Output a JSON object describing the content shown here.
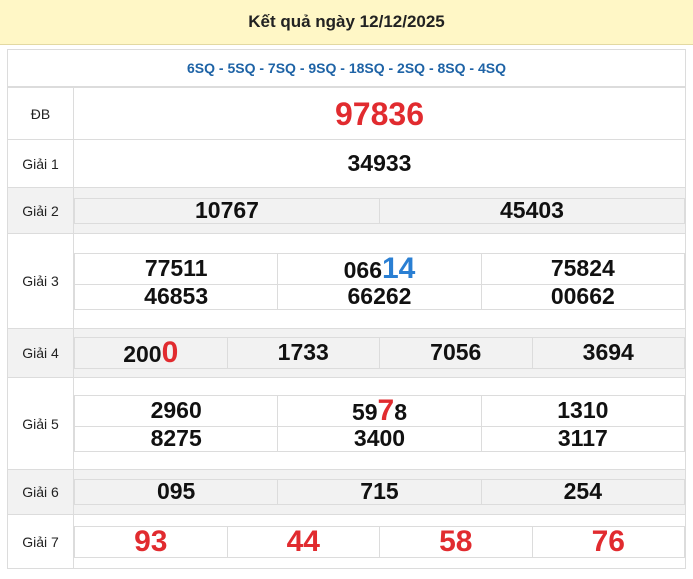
{
  "header": {
    "title": "Kết quả ngày 12/12/2025"
  },
  "codes": "6SQ - 5SQ - 7SQ - 9SQ - 18SQ - 2SQ - 8SQ - 4SQ",
  "db": {
    "label": "ĐB",
    "value": "97836"
  },
  "g1": {
    "label": "Giải 1",
    "value": "34933"
  },
  "g2": {
    "label": "Giải 2",
    "values": [
      "10767",
      "45403"
    ]
  },
  "g3": {
    "label": "Giải 3",
    "row1": [
      {
        "pre": "77511",
        "hl": ""
      },
      {
        "pre": "066",
        "hl": "14"
      },
      {
        "pre": "75824",
        "hl": ""
      }
    ],
    "row2": [
      "46853",
      "66262",
      "00662"
    ]
  },
  "g4": {
    "label": "Giải 4",
    "values": [
      {
        "pre": "200",
        "hl": "0"
      },
      {
        "pre": "1733",
        "hl": ""
      },
      {
        "pre": "7056",
        "hl": ""
      },
      {
        "pre": "3694",
        "hl": ""
      }
    ]
  },
  "g5": {
    "label": "Giải 5",
    "row1": [
      {
        "pre": "2960",
        "hl": "",
        "post": ""
      },
      {
        "pre": "59",
        "hl": "7",
        "post": "8"
      },
      {
        "pre": "1310",
        "hl": "",
        "post": ""
      }
    ],
    "row2": [
      "8275",
      "3400",
      "3117"
    ]
  },
  "g6": {
    "label": "Giải 6",
    "values": [
      "095",
      "715",
      "254"
    ]
  },
  "g7": {
    "label": "Giải 7",
    "values": [
      "93",
      "44",
      "58",
      "76"
    ]
  },
  "colors": {
    "red": "#e12b2f",
    "blue": "#2a7fd3",
    "header_bg": "#fff7c6",
    "codes": "#1e63a6"
  }
}
